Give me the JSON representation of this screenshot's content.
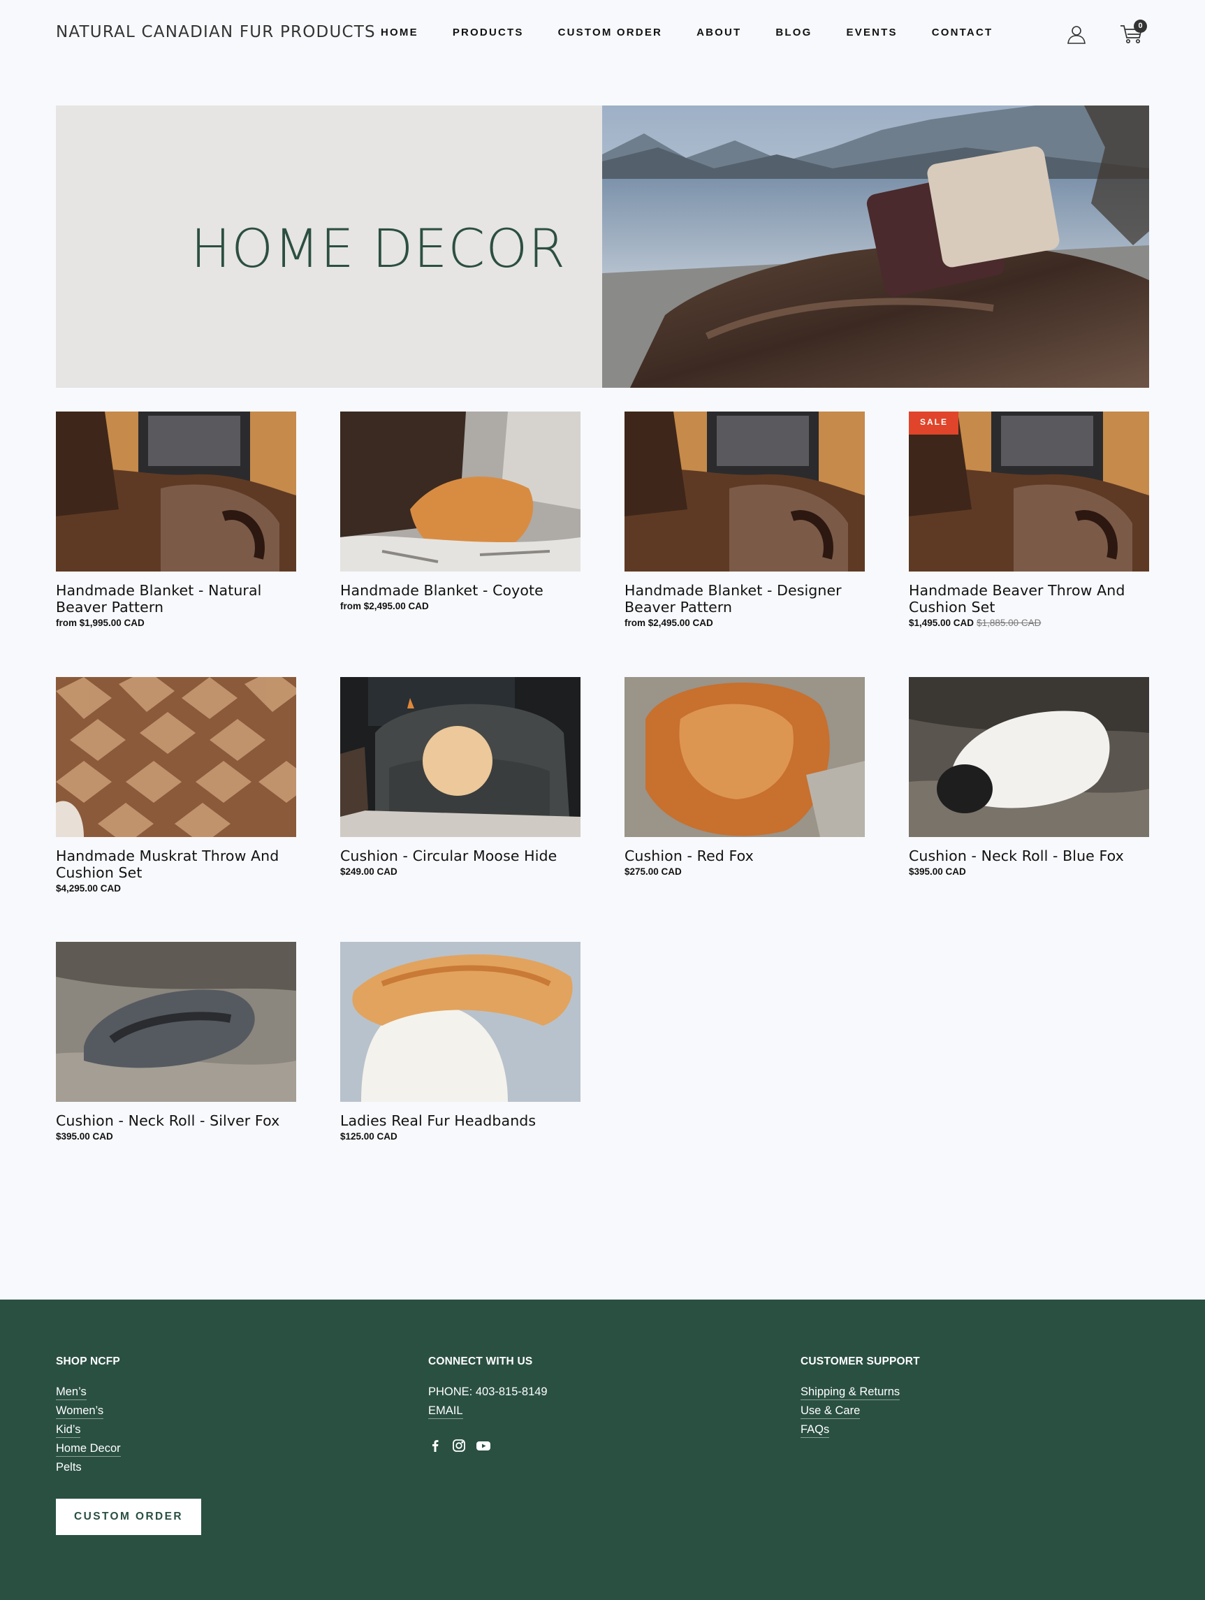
{
  "header": {
    "logo": "NATURAL CANADIAN FUR PRODUCTS",
    "nav": [
      "HOME",
      "PRODUCTS",
      "CUSTOM ORDER",
      "ABOUT",
      "BLOG",
      "EVENTS",
      "CONTACT"
    ],
    "cart_count": "0",
    "user_icon": "user-icon",
    "cart_icon": "cart-icon"
  },
  "hero": {
    "title": "HOME DECOR"
  },
  "products": [
    {
      "name": "Handmade Blanket - Natural Beaver Pattern",
      "price": "from $1,995.00 CAD",
      "old_price": ""
    },
    {
      "name": "Handmade Blanket - Coyote",
      "price": "from $2,495.00 CAD",
      "old_price": ""
    },
    {
      "name": "Handmade Blanket - Designer Beaver Pattern",
      "price": "from $2,495.00 CAD",
      "old_price": ""
    },
    {
      "name": "Handmade Beaver Throw And Cushion Set",
      "price": "$1,495.00 CAD",
      "old_price": "$1,885.00 CAD",
      "badge": "SALE"
    },
    {
      "name": "Handmade Muskrat Throw And Cushion Set",
      "price": "$4,295.00 CAD",
      "old_price": ""
    },
    {
      "name": "Cushion - Circular Moose Hide",
      "price": "$249.00 CAD",
      "old_price": ""
    },
    {
      "name": "Cushion - Red Fox",
      "price": "$275.00 CAD",
      "old_price": ""
    },
    {
      "name": "Cushion - Neck Roll - Blue Fox",
      "price": "$395.00 CAD",
      "old_price": ""
    },
    {
      "name": "Cushion - Neck Roll - Silver Fox",
      "price": "$395.00 CAD",
      "old_price": ""
    },
    {
      "name": "Ladies Real Fur Headbands",
      "price": "$125.00 CAD",
      "old_price": ""
    }
  ],
  "footer": {
    "shop": {
      "title": "SHOP NCFP",
      "links": [
        "Men’s",
        "Women’s",
        "Kid’s",
        "Home Decor",
        "Pelts"
      ]
    },
    "connect": {
      "title": "CONNECT WITH US",
      "phone": "PHONE: 403-815-8149",
      "email": "EMAIL",
      "social_icons": [
        "facebook-icon",
        "instagram-icon",
        "youtube-icon"
      ]
    },
    "support": {
      "title": "CUSTOMER SUPPORT",
      "links": [
        "Shipping & Returns",
        "Use & Care",
        "FAQs"
      ]
    },
    "custom_order_button": "CUSTOM ORDER"
  },
  "colors": {
    "brand_green": "#2a5042",
    "hero_text": "#2c4f41",
    "sale_badge": "#e0442a",
    "background": "#f8f9fc"
  }
}
